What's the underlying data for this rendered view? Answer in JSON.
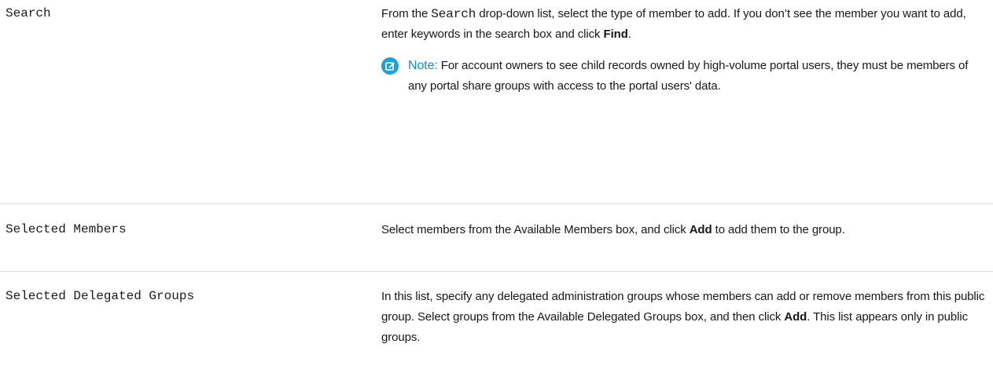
{
  "rows": [
    {
      "field": "Search",
      "desc": {
        "p1": "From the ",
        "p1_code": "Search",
        "p2": " drop-down list, select the type of member to add. If you don’t see the member you want to add, enter keywords in the search box and click ",
        "p2_bold": "Find",
        "p3": "."
      },
      "note": {
        "label": "Note:",
        "text": "For account owners to see child records owned by high-volume portal users, they must be members of any portal share groups with access to the portal users' data.",
        "icon": "edit-note-icon",
        "color": "#1aa1d8"
      }
    },
    {
      "field": "Selected Members",
      "desc": {
        "p1": "Select members from the Available Members box, and click ",
        "p1_bold": "Add",
        "p2": " to add them to the group."
      }
    },
    {
      "field": "Selected Delegated Groups",
      "desc": {
        "p1": "In this list, specify any delegated administration groups whose members can add or remove members from this public group. Select groups from the Available Delegated Groups box, and then click ",
        "p1_bold": "Add",
        "p2": ". This list appears only in public groups."
      }
    }
  ]
}
